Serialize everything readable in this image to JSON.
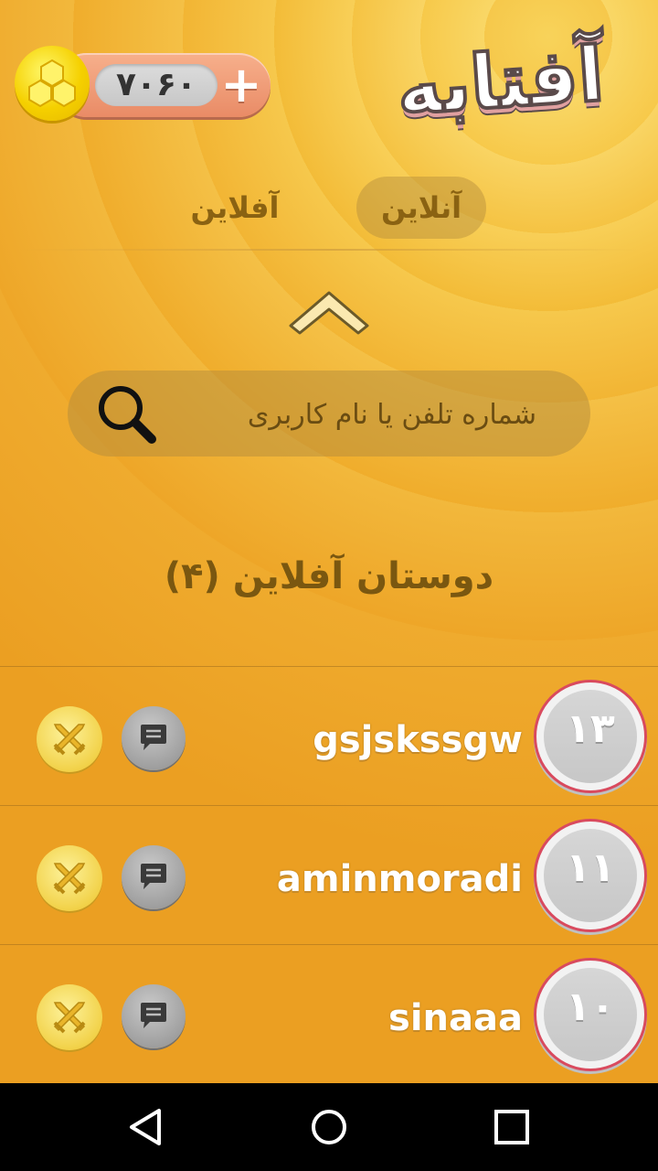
{
  "header": {
    "logo_text": "آفتابه",
    "coins": "۷۰۶۰",
    "add_label": "+"
  },
  "tabs": [
    {
      "label": "آنلاین",
      "active": true
    },
    {
      "label": "آفلاین",
      "active": false
    }
  ],
  "search": {
    "placeholder": "شماره تلفن یا نام کاربری"
  },
  "section_title": "دوستان آفلاین (۴)",
  "friends": [
    {
      "username": "gsjskssgw",
      "level": "۱۳"
    },
    {
      "username": "aminmoradi",
      "level": "۱۱"
    },
    {
      "username": "sinaaa",
      "level": "۱۰"
    }
  ],
  "colors": {
    "background": "#f3b632",
    "level_ring": "#d94a5e",
    "tab_text": "#8a6212"
  },
  "icons": {
    "coin": "honeycomb-coin-icon",
    "search": "search-icon",
    "collapse": "chevron-up-icon",
    "battle": "crossed-swords-icon",
    "chat": "chat-bubble-icon",
    "nav": [
      "back-icon",
      "home-icon",
      "recents-icon"
    ]
  }
}
